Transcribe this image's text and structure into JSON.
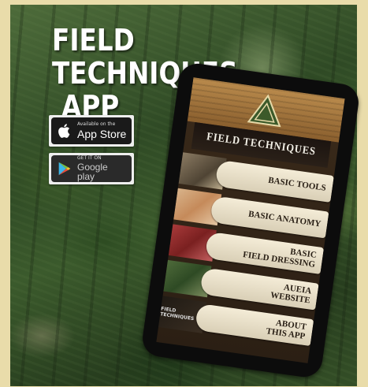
{
  "title": {
    "line1": "FIELD TECHNIQUES",
    "line2": "APP"
  },
  "badges": {
    "app_store": {
      "small": "Available on the",
      "big": "App Store"
    },
    "google_play": {
      "small": "GET IT ON",
      "big": "Google play"
    }
  },
  "phone": {
    "heading": "FIELD TECHNIQUES",
    "menu": [
      {
        "lines": [
          "BASIC TOOLS"
        ]
      },
      {
        "lines": [
          "BASIC ANATOMY"
        ]
      },
      {
        "lines": [
          "BASIC",
          "FIELD DRESSING"
        ]
      },
      {
        "lines": [
          "AUEIA",
          "WEBSITE"
        ]
      },
      {
        "lines": [
          "ABOUT",
          "THIS APP"
        ],
        "thumb_text": "FIELD TECHNIQUES"
      }
    ]
  },
  "colors": {
    "background": "#e9dcaa",
    "title_text": "#ffffff",
    "button_fill": "#f4ecd7"
  }
}
